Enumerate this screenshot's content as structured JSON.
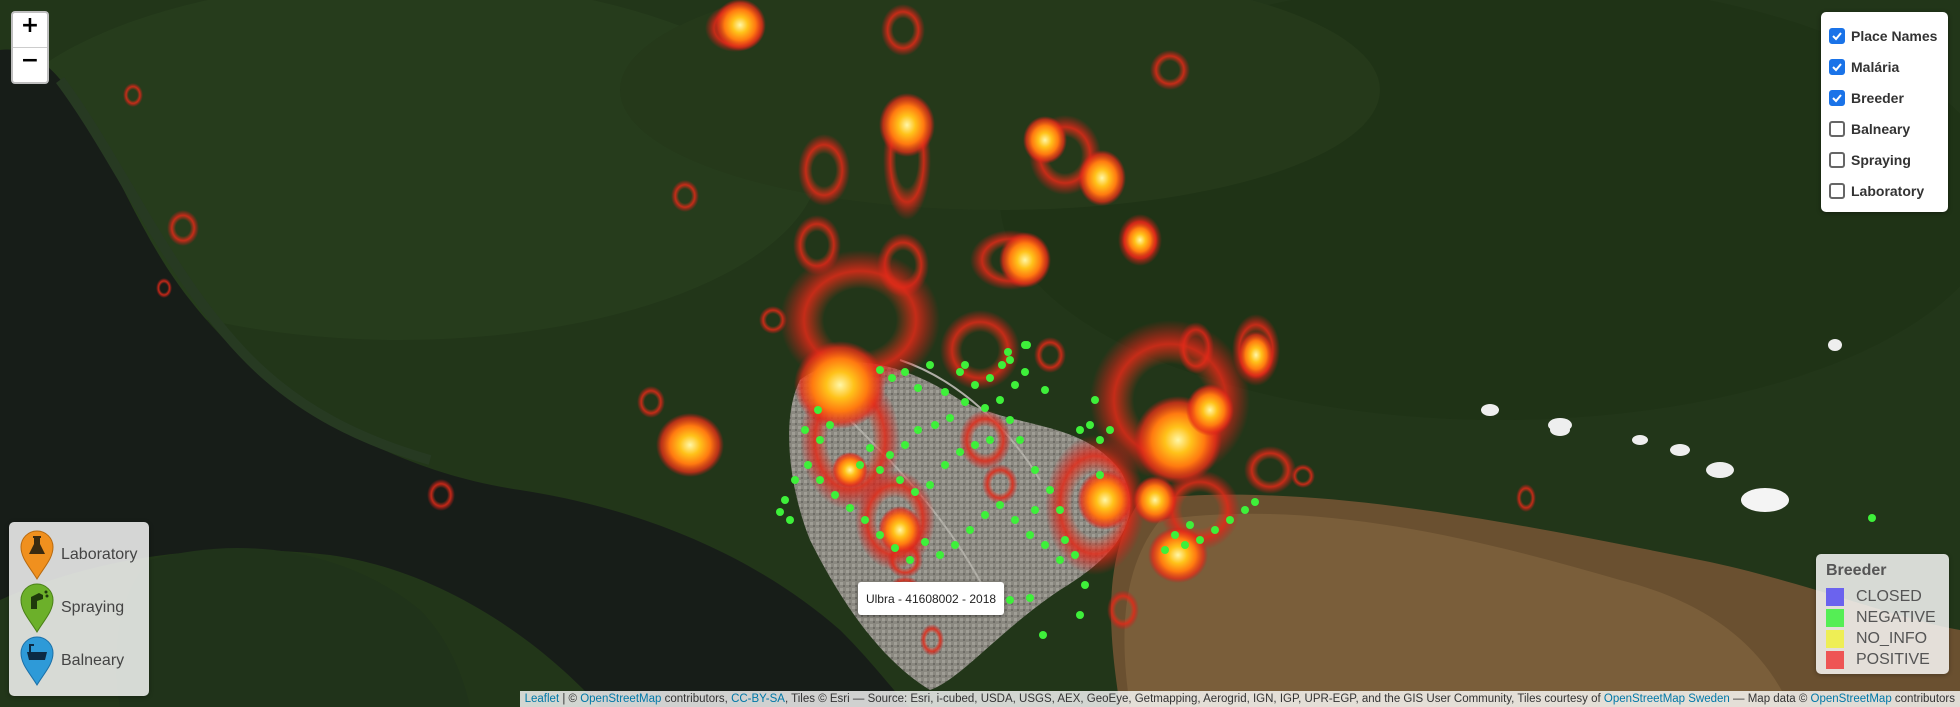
{
  "zoom": {
    "in_label": "+",
    "out_label": "−"
  },
  "layers": [
    {
      "label": "Place Names",
      "checked": true
    },
    {
      "label": "Malária",
      "checked": true
    },
    {
      "label": "Breeder",
      "checked": true
    },
    {
      "label": "Balneary",
      "checked": false
    },
    {
      "label": "Spraying",
      "checked": false
    },
    {
      "label": "Laboratory",
      "checked": false
    }
  ],
  "poi_legend": [
    {
      "label": "Laboratory",
      "icon": "flask-icon",
      "color": "#f0901e"
    },
    {
      "label": "Spraying",
      "icon": "spray-icon",
      "color": "#6cb02a"
    },
    {
      "label": "Balneary",
      "icon": "bathtub-icon",
      "color": "#2e9ad8"
    }
  ],
  "breeder_legend": {
    "title": "Breeder",
    "items": [
      {
        "label": "CLOSED",
        "color": "#6b63ee"
      },
      {
        "label": "NEGATIVE",
        "color": "#55ee55"
      },
      {
        "label": "NO_INFO",
        "color": "#eeee55"
      },
      {
        "label": "POSITIVE",
        "color": "#ee5555"
      }
    ]
  },
  "tooltip": "Ulbra - 41608002 - 2018",
  "attribution": {
    "leaflet": "Leaflet",
    "sep1": " | © ",
    "osm": "OpenStreetMap",
    "t1": " contributors, ",
    "ccbysa": "CC-BY-SA",
    "t2": ", Tiles © Esri — Source: Esri, i-cubed, USDA, USGS, AEX, GeoEye, Getmapping, Aerogrid, IGN, IGP, UPR-EGP, and the GIS User Community, Tiles courtesy of ",
    "osm_sweden": "OpenStreetMap Sweden",
    "t3": " — Map data © ",
    "osm2": "OpenStreetMap",
    "t4": " contributors"
  }
}
